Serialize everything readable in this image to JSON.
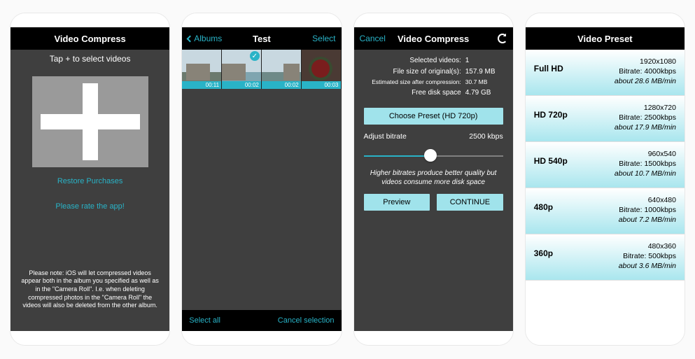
{
  "accent": "#29b3c7",
  "screen1": {
    "title": "Video Compress",
    "instruction": "Tap + to select videos",
    "restore": "Restore Purchases",
    "rate": "Please rate the app!",
    "note": "Please note: iOS will let compressed videos appear both in the album you specified as well as in the \"Camera Roll\". I.e. when deleting compressed photos in the \"Camera Roll\" the videos will also be deleted from the other album."
  },
  "screen2": {
    "back": "Albums",
    "title": "Test",
    "right": "Select",
    "thumbs": [
      {
        "duration": "00:11",
        "selected": false
      },
      {
        "duration": "00:02",
        "selected": true
      },
      {
        "duration": "00:02",
        "selected": false
      },
      {
        "duration": "00:03",
        "selected": false
      }
    ],
    "selectAll": "Select all",
    "cancelSel": "Cancel selection"
  },
  "screen3": {
    "left": "Cancel",
    "title": "Video Compress",
    "rows": {
      "selected_label": "Selected videos:",
      "selected_value": "1",
      "filesize_label": "File size of original(s):",
      "filesize_value": "157.9 MB",
      "estsize_label": "Estimated size after compression:",
      "estsize_value": "30.7 MB",
      "freedisk_label": "Free disk space",
      "freedisk_value": "4.79 GB"
    },
    "choosePreset": "Choose Preset (HD 720p)",
    "adjustLabel": "Adjust bitrate",
    "bitrateValue": "2500 kbps",
    "note": "Higher bitrates produce better quality but videos consume more disk space",
    "preview": "Preview",
    "continue": "CONTINUE"
  },
  "screen4": {
    "title": "Video Preset",
    "presets": [
      {
        "name": "Full HD",
        "res": "1920x1080",
        "bitrate": "Bitrate: 4000kbps",
        "rate": "about 28.6 MB/min"
      },
      {
        "name": "HD 720p",
        "res": "1280x720",
        "bitrate": "Bitrate: 2500kbps",
        "rate": "about 17.9 MB/min"
      },
      {
        "name": "HD 540p",
        "res": "960x540",
        "bitrate": "Bitrate: 1500kbps",
        "rate": "about 10.7 MB/min"
      },
      {
        "name": "480p",
        "res": "640x480",
        "bitrate": "Bitrate: 1000kbps",
        "rate": "about 7.2 MB/min"
      },
      {
        "name": "360p",
        "res": "480x360",
        "bitrate": "Bitrate: 500kbps",
        "rate": "about 3.6 MB/min"
      }
    ]
  }
}
